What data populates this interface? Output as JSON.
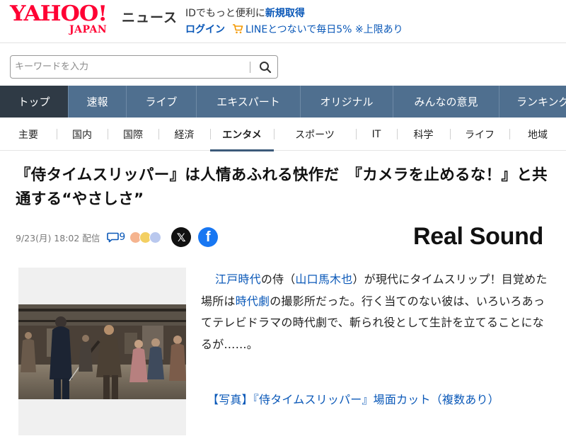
{
  "header": {
    "logo_main": "YAHOO!",
    "logo_sub": "JAPAN",
    "service_name": "ニュース",
    "promo_text": "IDでもっと便利に",
    "promo_link": "新規取得",
    "login": "ログイン",
    "line_promo": "LINEとつないで毎日5% ※上限あり"
  },
  "search": {
    "placeholder": "キーワードを入力"
  },
  "main_nav": [
    {
      "label": "トップ"
    },
    {
      "label": "速報"
    },
    {
      "label": "ライブ"
    },
    {
      "label": "エキスパート"
    },
    {
      "label": "オリジナル"
    },
    {
      "label": "みんなの意見"
    },
    {
      "label": "ランキング"
    }
  ],
  "sub_nav": [
    {
      "label": "主要"
    },
    {
      "label": "国内"
    },
    {
      "label": "国際"
    },
    {
      "label": "経済"
    },
    {
      "label": "エンタメ"
    },
    {
      "label": "スポーツ"
    },
    {
      "label": "IT"
    },
    {
      "label": "科学"
    },
    {
      "label": "ライフ"
    },
    {
      "label": "地域"
    }
  ],
  "article": {
    "title": "『侍タイムスリッパー』は人情あふれる快作だ　『カメラを止めるな！』と共通する“やさしさ”",
    "date": "9/23(月) 18:02",
    "delivery": "配信",
    "comment_count": "9",
    "provider": "Real Sound",
    "body": {
      "link1": "江戸時代",
      "text1": "の侍（",
      "link2": "山口馬木也",
      "text2": "）が現代にタイムスリップ！目覚めた場所は",
      "link3": "時代劇",
      "text3": "の撮影所だった。行く当てのない彼は、いろいろあってテレビドラマの時代劇で、斬られ役として生計を立てることになるが……。"
    },
    "related_link": "【写真】『侍タイムスリッパー』場面カット（複数あり）"
  },
  "colors": {
    "brand_red": "#ff0033",
    "nav_bg": "#4f6f8f",
    "nav_active": "#2f3a45",
    "link_blue": "#0a58b8"
  }
}
